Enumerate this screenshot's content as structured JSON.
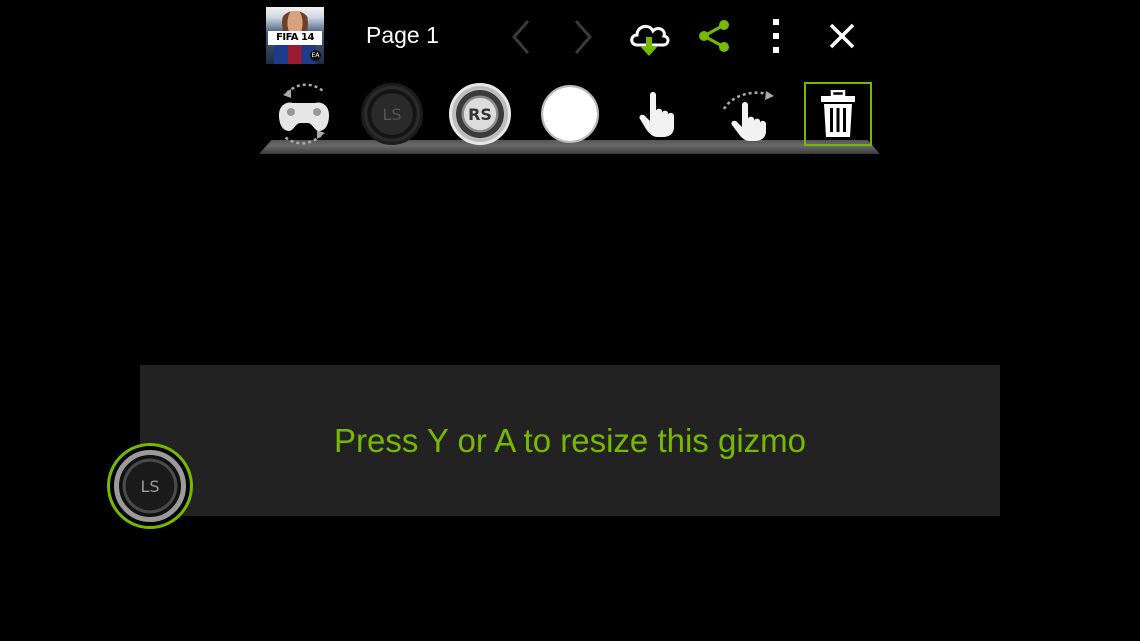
{
  "header": {
    "game_title": "FIFA 14",
    "page_label": "Page 1",
    "icons": [
      "back-chevron-icon",
      "forward-chevron-icon",
      "cloud-download-icon",
      "share-icon",
      "overflow-menu-icon",
      "close-icon"
    ]
  },
  "toolbar": {
    "tools": [
      {
        "name": "gamepad-rotate-tool",
        "label": ""
      },
      {
        "name": "left-stick-tool",
        "label": "LS"
      },
      {
        "name": "right-stick-tool",
        "label": "RS"
      },
      {
        "name": "button-tool",
        "label": ""
      },
      {
        "name": "tap-gesture-tool",
        "label": ""
      },
      {
        "name": "swipe-gesture-tool",
        "label": ""
      },
      {
        "name": "delete-tool",
        "label": ""
      }
    ],
    "selected_tool": "delete-tool"
  },
  "message": {
    "text": "Press Y or A to resize this gizmo"
  },
  "gizmo": {
    "label": "LS"
  },
  "colors": {
    "accent": "#76b900",
    "background": "#000000",
    "panel": "#222222"
  }
}
